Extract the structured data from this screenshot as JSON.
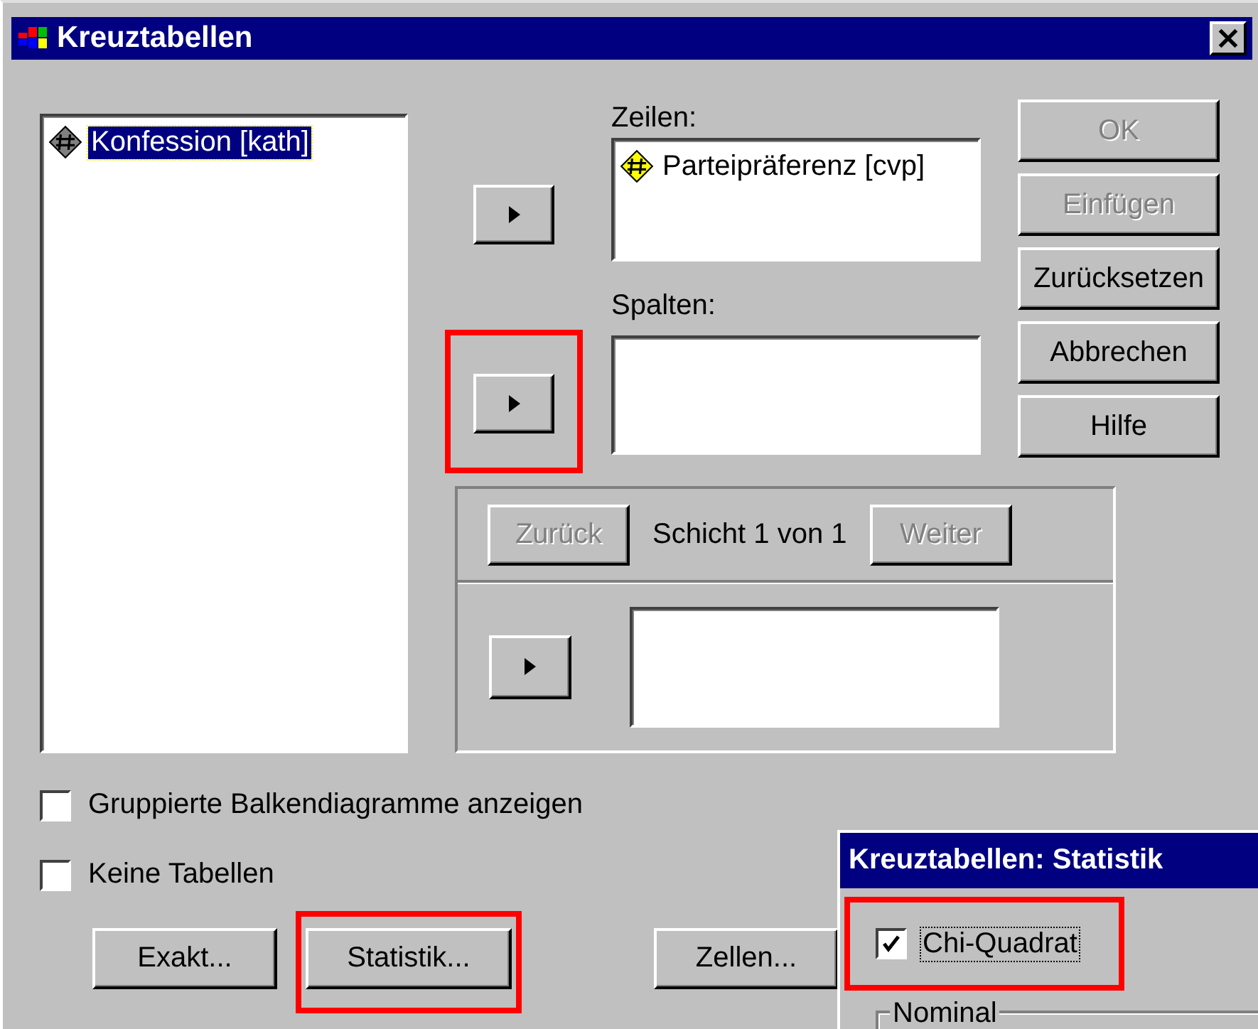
{
  "window": {
    "title": "Kreuztabellen"
  },
  "source_list": {
    "items": [
      {
        "label": "Konfession [kath]",
        "selected": true,
        "color": "#808080"
      }
    ]
  },
  "rows": {
    "label": "Zeilen:",
    "arrow_highlighted": false,
    "items": [
      {
        "label": "Parteipräferenz [cvp]",
        "selected": false,
        "color": "#ffff00"
      }
    ]
  },
  "columns": {
    "label": "Spalten:",
    "arrow_highlighted": true
  },
  "actions": [
    {
      "label": "OK",
      "disabled": true
    },
    {
      "label": "Einfügen",
      "disabled": true
    },
    {
      "label": "Zurücksetzen",
      "disabled": false
    },
    {
      "label": "Abbrechen",
      "disabled": false
    },
    {
      "label": "Hilfe",
      "disabled": false
    }
  ],
  "layer": {
    "prev": {
      "label": "Zurück",
      "disabled": true
    },
    "status": "Schicht 1 von 1",
    "next": {
      "label": "Weiter",
      "disabled": true
    }
  },
  "options": [
    {
      "label": "Gruppierte Balkendiagramme anzeigen",
      "checked": false
    },
    {
      "label": "Keine Tabellen",
      "checked": false
    }
  ],
  "bottom_buttons": [
    {
      "label": "Exakt...",
      "highlighted": false
    },
    {
      "label": "Statistik...",
      "highlighted": true
    },
    {
      "label": "Zellen...",
      "highlighted": false
    }
  ],
  "statistics_dialog": {
    "title": "Kreuztabellen: Statistik",
    "options": [
      {
        "label": "Chi-Quadrat",
        "checked": true,
        "highlighted": true
      }
    ],
    "group_label": "Nominal"
  }
}
